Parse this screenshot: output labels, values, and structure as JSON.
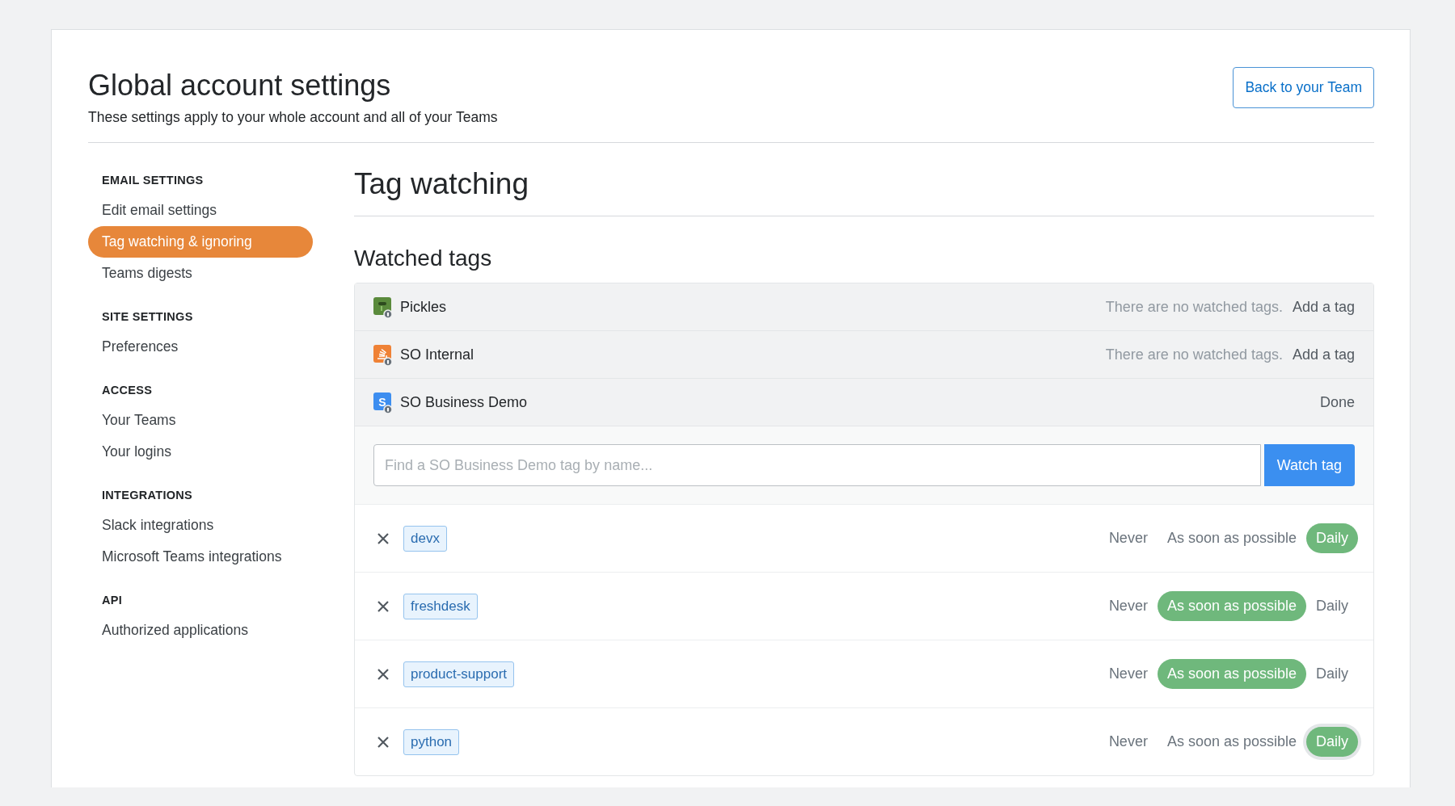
{
  "header": {
    "title": "Global account settings",
    "subtitle": "These settings apply to your whole account and all of your Teams",
    "back_button": "Back to your Team"
  },
  "sidebar": {
    "sections": [
      {
        "heading": "EMAIL SETTINGS",
        "items": [
          {
            "label": "Edit email settings",
            "selected": false
          },
          {
            "label": "Tag watching & ignoring",
            "selected": true
          },
          {
            "label": "Teams digests",
            "selected": false
          }
        ]
      },
      {
        "heading": "SITE SETTINGS",
        "items": [
          {
            "label": "Preferences",
            "selected": false
          }
        ]
      },
      {
        "heading": "ACCESS",
        "items": [
          {
            "label": "Your Teams",
            "selected": false
          },
          {
            "label": "Your logins",
            "selected": false
          }
        ]
      },
      {
        "heading": "INTEGRATIONS",
        "items": [
          {
            "label": "Slack integrations",
            "selected": false
          },
          {
            "label": "Microsoft Teams integrations",
            "selected": false
          }
        ]
      },
      {
        "heading": "API",
        "items": [
          {
            "label": "Authorized applications",
            "selected": false
          }
        ]
      }
    ]
  },
  "main": {
    "title": "Tag watching",
    "section_title": "Watched tags",
    "teams": [
      {
        "name": "Pickles",
        "kind": "pickle",
        "color": "#5a8a3c",
        "status": "There are no watched tags.",
        "action": "Add a tag"
      },
      {
        "name": "SO Internal",
        "kind": "stack",
        "color": "#ef8236",
        "status": "There are no watched tags.",
        "action": "Add a tag"
      },
      {
        "name": "SO Business Demo",
        "kind": "letter",
        "icon_text": "S",
        "color": "#3d8ef0",
        "action": "Done"
      }
    ],
    "search": {
      "placeholder": "Find a SO Business Demo tag by name...",
      "button": "Watch tag"
    },
    "tags": [
      {
        "name": "devx",
        "options": [
          {
            "label": "Never",
            "selected": false,
            "focused": false
          },
          {
            "label": "As soon as possible",
            "selected": false,
            "focused": false
          },
          {
            "label": "Daily",
            "selected": true,
            "focused": false
          }
        ]
      },
      {
        "name": "freshdesk",
        "options": [
          {
            "label": "Never",
            "selected": false,
            "focused": false
          },
          {
            "label": "As soon as possible",
            "selected": true,
            "focused": false
          },
          {
            "label": "Daily",
            "selected": false,
            "focused": false
          }
        ]
      },
      {
        "name": "product-support",
        "options": [
          {
            "label": "Never",
            "selected": false,
            "focused": false
          },
          {
            "label": "As soon as possible",
            "selected": true,
            "focused": false
          },
          {
            "label": "Daily",
            "selected": false,
            "focused": false
          }
        ]
      },
      {
        "name": "python",
        "options": [
          {
            "label": "Never",
            "selected": false,
            "focused": false
          },
          {
            "label": "As soon as possible",
            "selected": false,
            "focused": false
          },
          {
            "label": "Daily",
            "selected": true,
            "focused": true
          }
        ]
      }
    ]
  }
}
